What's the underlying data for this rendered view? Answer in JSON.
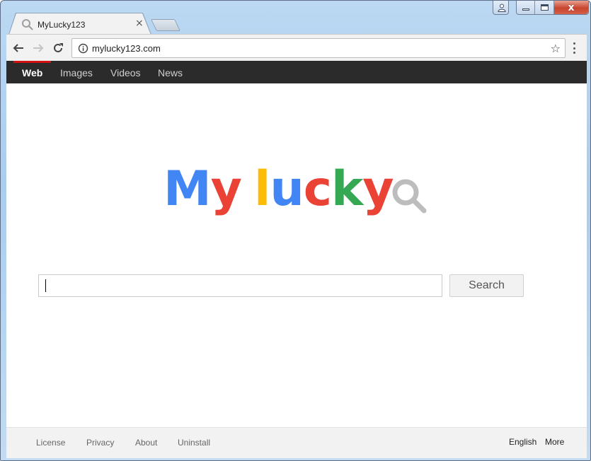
{
  "window": {
    "controls": {
      "user": "user-icon",
      "minimize": "minimize-icon",
      "maximize": "maximize-icon",
      "close": "close-icon",
      "close_glyph": "x"
    }
  },
  "browser": {
    "tab": {
      "title": "MyLucky123",
      "icon": "search-icon",
      "close_glyph": "×"
    },
    "new_tab": "new-tab",
    "toolbar": {
      "back": "back-arrow-icon",
      "forward": "forward-arrow-icon",
      "reload": "reload-icon",
      "url": "mylucky123.com",
      "info_icon": "info-icon",
      "star_glyph": "☆",
      "menu": "more-vert-icon"
    }
  },
  "page": {
    "topnav": {
      "items": [
        {
          "label": "Web",
          "active": true
        },
        {
          "label": "Images",
          "active": false
        },
        {
          "label": "Videos",
          "active": false
        },
        {
          "label": "News",
          "active": false
        }
      ],
      "active_color": "#d21212"
    },
    "logo": {
      "letters": [
        {
          "char": "M",
          "color": "#4285f4"
        },
        {
          "char": "y",
          "color": "#ea4335"
        },
        {
          "char": " ",
          "color": "#ffffff"
        },
        {
          "char": "l",
          "color": "#fbbc05"
        },
        {
          "char": "u",
          "color": "#4285f4"
        },
        {
          "char": "c",
          "color": "#ea4335"
        },
        {
          "char": "k",
          "color": "#34a853"
        },
        {
          "char": "y",
          "color": "#ea4335"
        }
      ],
      "magnifier_color": "#bdbdbd"
    },
    "search": {
      "value": "",
      "placeholder": "",
      "button_label": "Search"
    },
    "footer": {
      "left_links": [
        "License",
        "Privacy",
        "About",
        "Uninstall"
      ],
      "right_links": [
        "English",
        "More"
      ]
    }
  }
}
